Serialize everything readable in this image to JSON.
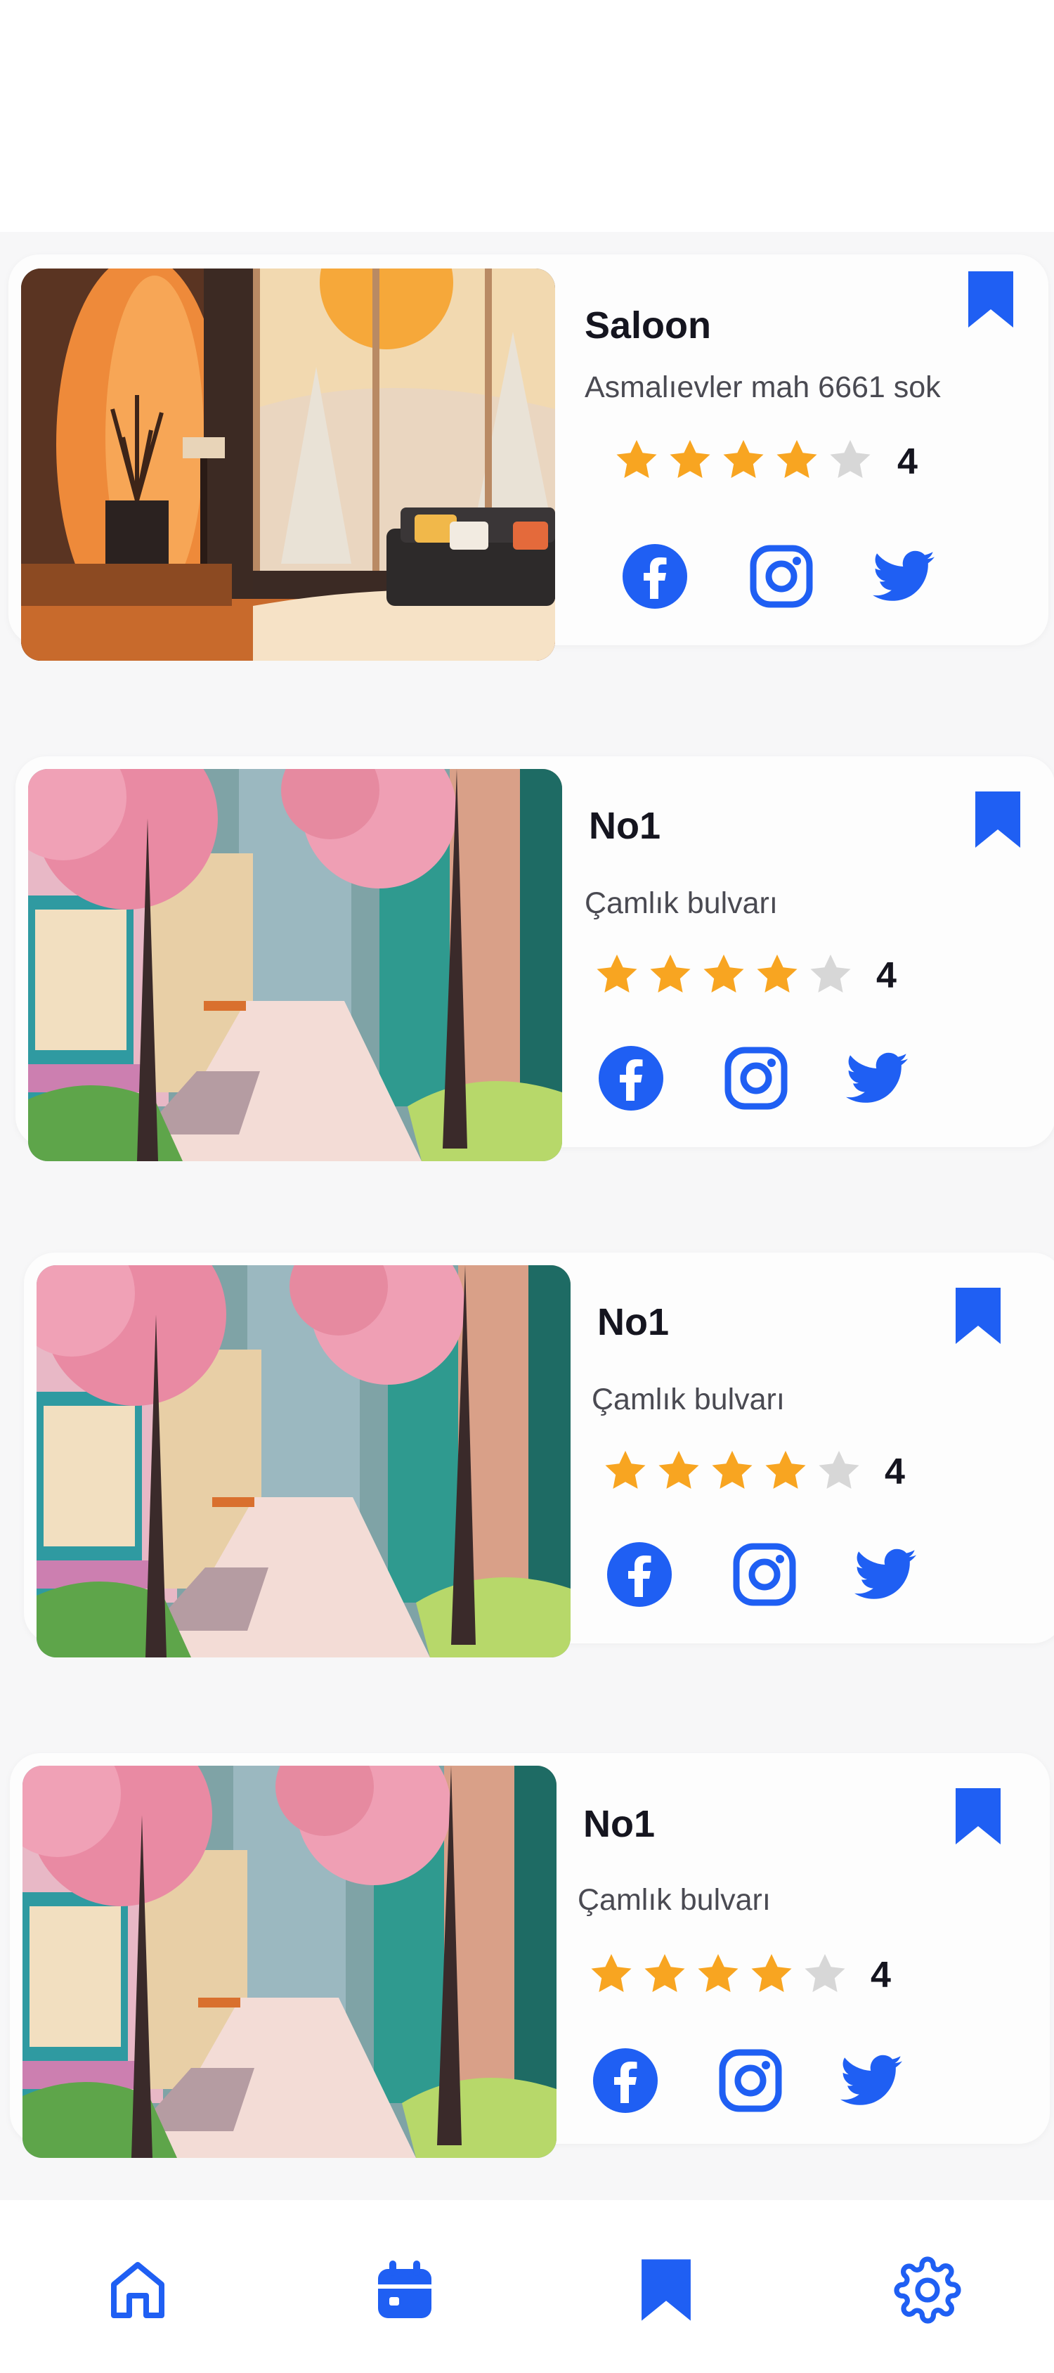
{
  "colors": {
    "accent": "#1f5ff3",
    "star_on": "#f8a521",
    "star_off": "#d7d7d7",
    "text": "#15151f",
    "muted": "#4a4a52"
  },
  "cards": [
    {
      "title": "Saloon",
      "address": "Asmalıevler mah 6661 sok",
      "rating": 4,
      "rating_label": "4",
      "image": "interior-room-illustration"
    },
    {
      "title": "No1",
      "address": "Çamlık bulvarı",
      "rating": 4,
      "rating_label": "4",
      "image": "street-blossom-illustration"
    },
    {
      "title": "No1",
      "address": "Çamlık bulvarı",
      "rating": 4,
      "rating_label": "4",
      "image": "street-blossom-illustration"
    },
    {
      "title": "No1",
      "address": "Çamlık bulvarı",
      "rating": 4,
      "rating_label": "4",
      "image": "street-blossom-illustration"
    }
  ],
  "social_icons": [
    "facebook-icon",
    "instagram-icon",
    "twitter-icon"
  ],
  "bottom_nav": [
    "home-icon",
    "calendar-icon",
    "bookmark-icon",
    "settings-icon"
  ]
}
